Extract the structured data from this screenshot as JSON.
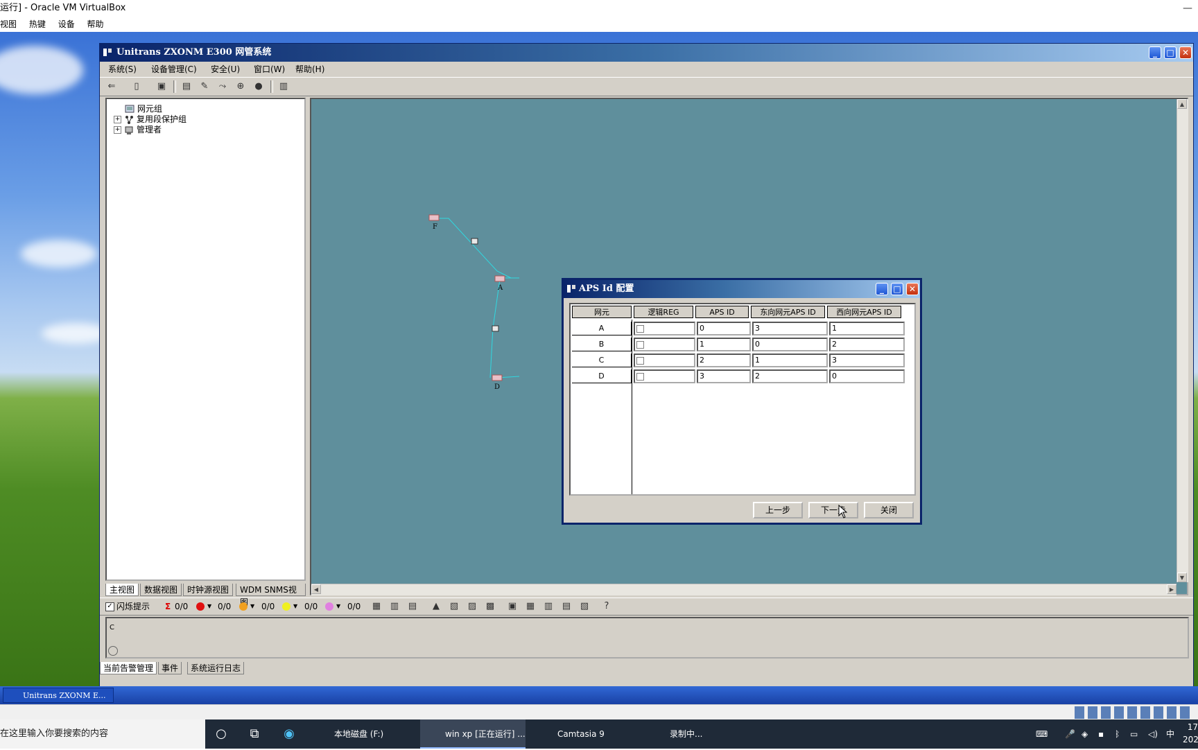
{
  "host_window": {
    "title": "运行] - Oracle VM VirtualBox",
    "menu": [
      "视图",
      "热键",
      "设备",
      "帮助"
    ]
  },
  "app": {
    "title": "Unitrans ZXONM E300 网管系统",
    "menu": [
      "系统(S)",
      "设备管理(C)",
      "安全(U)",
      "窗口(W)",
      "帮助(H)"
    ],
    "tree": [
      {
        "label": "网元组",
        "expandable": false
      },
      {
        "label": "复用段保护组",
        "expandable": true
      },
      {
        "label": "管理者",
        "expandable": true
      }
    ],
    "view_tabs": [
      "主视图",
      "数据视图",
      "时钟源视图",
      "WDM SNMS视图"
    ],
    "nodes": [
      {
        "label": "F"
      },
      {
        "label": "A"
      },
      {
        "label": "D"
      }
    ],
    "alarm_bar": {
      "flash_label": "闪烁提示",
      "flash_checked": true,
      "counts": [
        "0/0",
        "0/0",
        "0/0",
        "0/0",
        "0/0"
      ],
      "dot_colors": [
        "#e01010",
        "#f0a020",
        "#f0f020",
        "#e080e0"
      ]
    },
    "log_letters": [
      "C"
    ],
    "bottom_tabs": [
      "当前告警管理",
      "事件",
      "系统运行日志"
    ],
    "taskbar_item": "Unitrans ZXONM E..."
  },
  "dialog": {
    "title": "APS Id 配置",
    "columns": [
      "网元",
      "逻辑REG",
      "APS ID",
      "东向网元APS ID",
      "西向网元APS ID"
    ],
    "rows": [
      {
        "ne": "A",
        "reg": false,
        "aps_id": "0",
        "east": "3",
        "west": "1"
      },
      {
        "ne": "B",
        "reg": false,
        "aps_id": "1",
        "east": "0",
        "west": "2"
      },
      {
        "ne": "C",
        "reg": false,
        "aps_id": "2",
        "east": "1",
        "west": "3"
      },
      {
        "ne": "D",
        "reg": false,
        "aps_id": "3",
        "east": "2",
        "west": "0"
      }
    ],
    "buttons": {
      "prev": "上一步",
      "next": "下一步",
      "close": "关闭"
    }
  },
  "host_taskbar": {
    "search_placeholder": "在这里输入你要搜索的内容",
    "tasks": [
      "本地磁盘 (F:)",
      "win xp [正在运行] ...",
      "Camtasia 9",
      "录制中..."
    ],
    "tray_lang": "中",
    "clock_time": "17",
    "clock_date": "202"
  }
}
